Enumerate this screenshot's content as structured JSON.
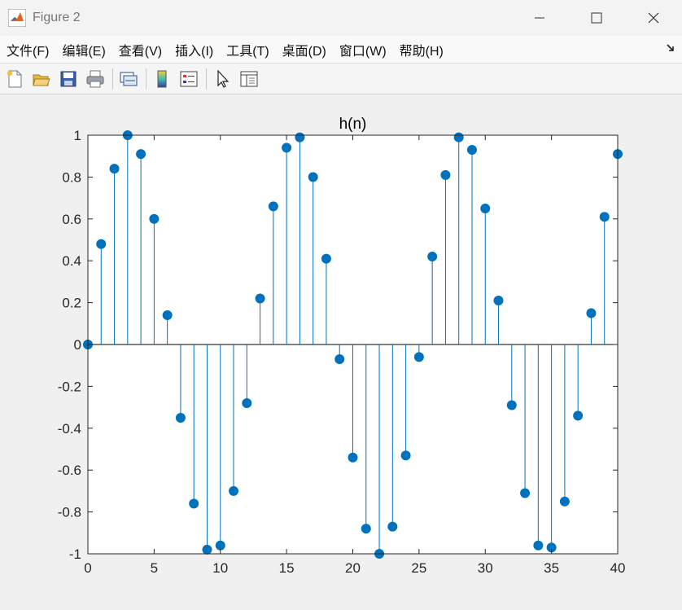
{
  "window": {
    "title": "Figure 2",
    "icons": [
      "matlab-logo-icon",
      "minimize-icon",
      "maximize-icon",
      "close-icon"
    ]
  },
  "menubar": {
    "items": [
      "文件(F)",
      "编辑(E)",
      "查看(V)",
      "插入(I)",
      "工具(T)",
      "桌面(D)",
      "窗口(W)",
      "帮助(H)"
    ]
  },
  "toolbar": {
    "buttons": [
      "new-figure-icon",
      "open-file-icon",
      "save-icon",
      "print-icon",
      "link-plot-icon",
      "colorbar-icon",
      "legend-icon",
      "pointer-icon",
      "property-inspector-icon"
    ]
  },
  "colors": {
    "stem": "#0072BD",
    "axes_background": "#ffffff",
    "figure_background": "#f0f0f0"
  },
  "chart_data": {
    "type": "stem",
    "title": "h(n)",
    "xlabel": "",
    "ylabel": "",
    "xlim": [
      0,
      40
    ],
    "ylim": [
      -1,
      1
    ],
    "xticks": [
      0,
      5,
      10,
      15,
      20,
      25,
      30,
      35,
      40
    ],
    "yticks": [
      -1,
      -0.8,
      -0.6,
      -0.4,
      -0.2,
      0,
      0.2,
      0.4,
      0.6,
      0.8,
      1
    ],
    "ytick_labels": [
      "-1",
      "-0.8",
      "-0.6",
      "-0.4",
      "-0.2",
      "0",
      "0.2",
      "0.4",
      "0.6",
      "0.8",
      "1"
    ],
    "grid": false,
    "x": [
      0,
      1,
      2,
      3,
      4,
      5,
      6,
      7,
      8,
      9,
      10,
      11,
      12,
      13,
      14,
      15,
      16,
      17,
      18,
      19,
      20,
      21,
      22,
      23,
      24,
      25,
      26,
      27,
      28,
      29,
      30,
      31,
      32,
      33,
      34,
      35,
      36,
      37,
      38,
      39,
      40
    ],
    "values": [
      0,
      0.48,
      0.84,
      1.0,
      0.91,
      0.6,
      0.14,
      -0.35,
      -0.76,
      -0.98,
      -0.96,
      -0.7,
      -0.28,
      0.22,
      0.66,
      0.94,
      0.99,
      0.8,
      0.41,
      -0.07,
      -0.54,
      -0.88,
      -1.0,
      -0.87,
      -0.53,
      -0.06,
      0.42,
      0.81,
      0.99,
      0.93,
      0.65,
      0.21,
      -0.29,
      -0.71,
      -0.96,
      -0.97,
      -0.75,
      -0.34,
      0.15,
      0.61,
      0.91
    ]
  }
}
